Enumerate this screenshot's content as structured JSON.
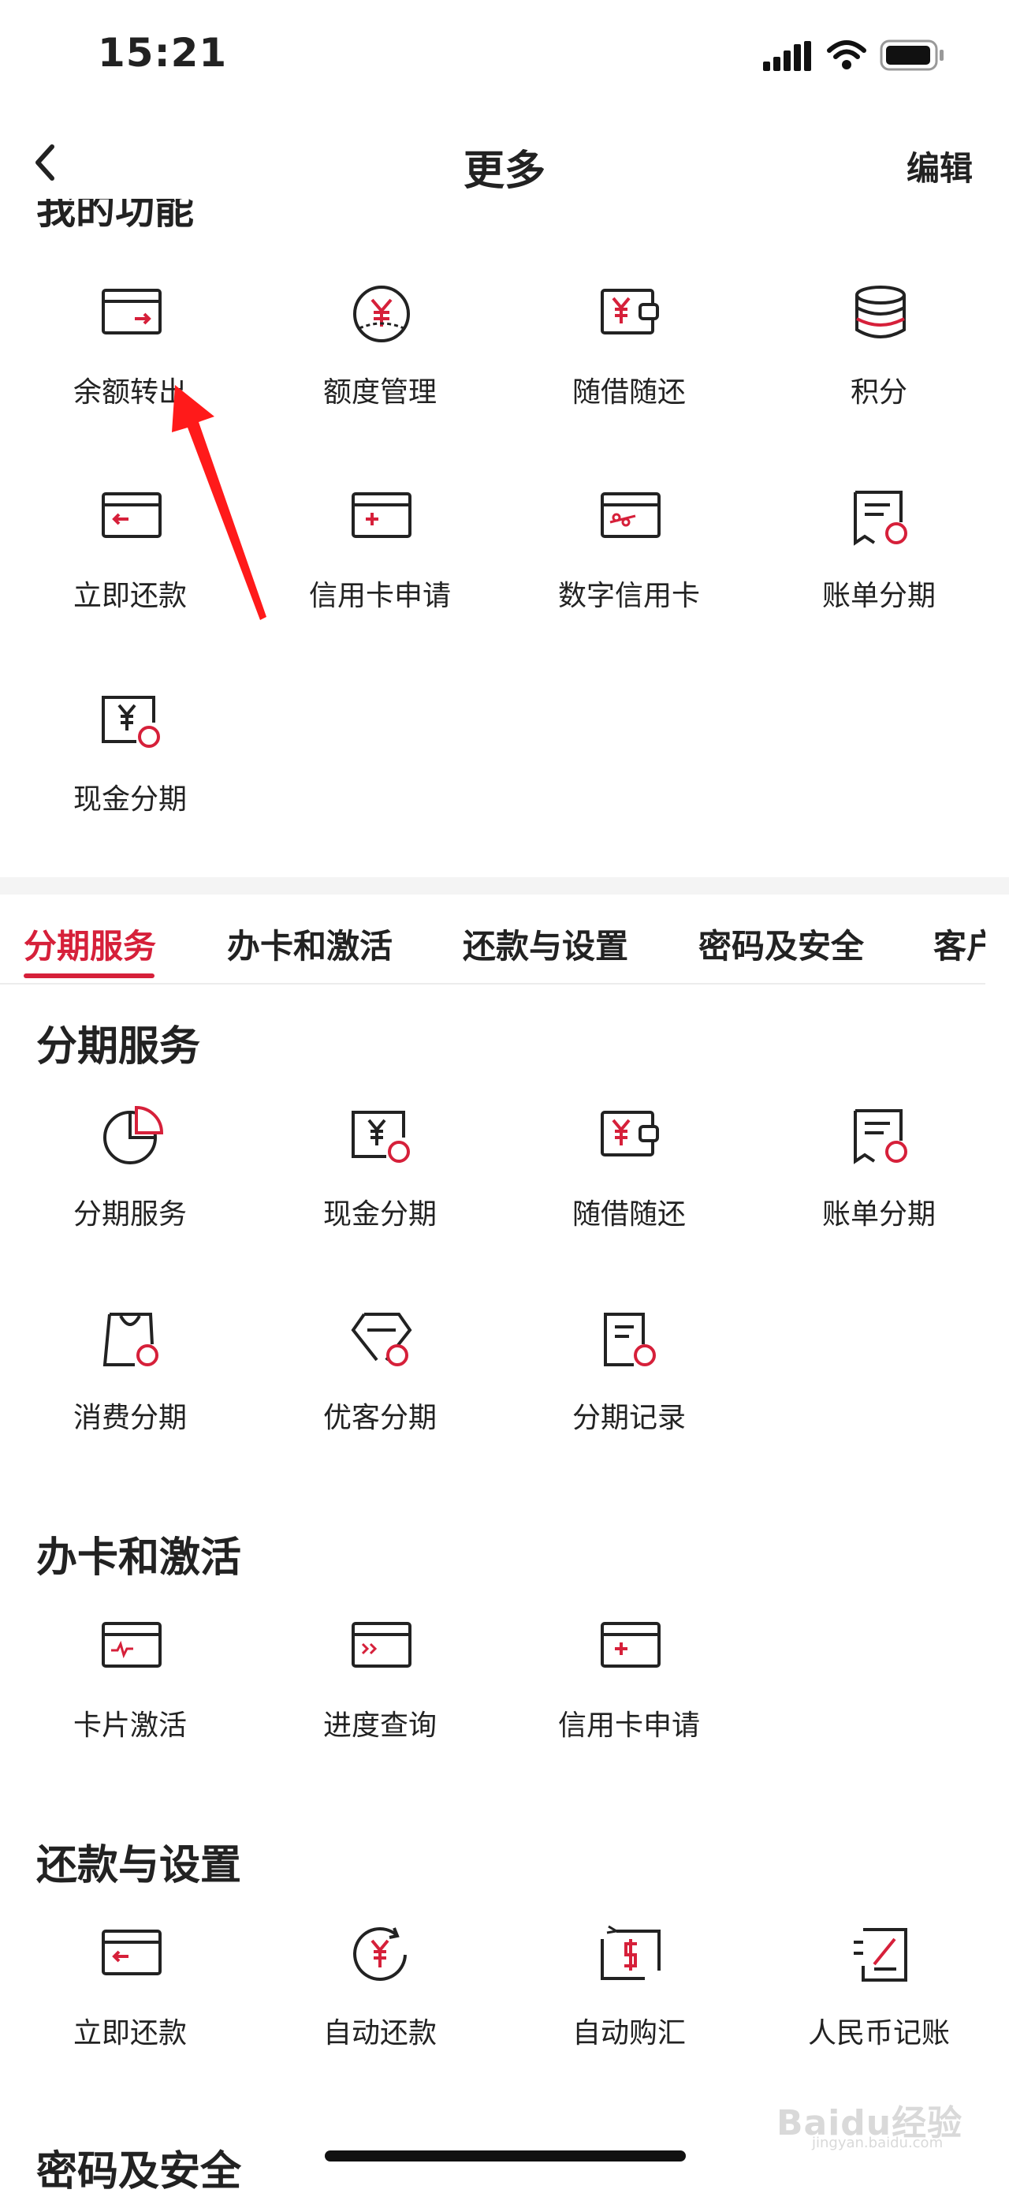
{
  "status_bar": {
    "time": "15:21"
  },
  "navbar": {
    "title": "更多",
    "edit": "编辑"
  },
  "my_functions": {
    "title": "我的功能",
    "items": [
      {
        "label": "余额转出",
        "icon": "card-transfer-out-icon"
      },
      {
        "label": "额度管理",
        "icon": "yuan-limit-icon"
      },
      {
        "label": "随借随还",
        "icon": "yuan-wallet-icon"
      },
      {
        "label": "积分",
        "icon": "points-stack-icon"
      },
      {
        "label": "立即还款",
        "icon": "card-repay-icon"
      },
      {
        "label": "信用卡申请",
        "icon": "card-apply-icon"
      },
      {
        "label": "数字信用卡",
        "icon": "digital-card-icon"
      },
      {
        "label": "账单分期",
        "icon": "bill-installment-icon"
      },
      {
        "label": "现金分期",
        "icon": "cash-installment-icon"
      }
    ]
  },
  "tabs": [
    "分期服务",
    "办卡和激活",
    "还款与设置",
    "密码及安全",
    "客户"
  ],
  "installment": {
    "title": "分期服务",
    "items": [
      {
        "label": "分期服务",
        "icon": "pie-chart-icon"
      },
      {
        "label": "现金分期",
        "icon": "cash-installment-icon"
      },
      {
        "label": "随借随还",
        "icon": "yuan-wallet-icon"
      },
      {
        "label": "账单分期",
        "icon": "bill-installment-icon"
      },
      {
        "label": "消费分期",
        "icon": "shopping-bag-icon"
      },
      {
        "label": "优客分期",
        "icon": "diamond-icon"
      },
      {
        "label": "分期记录",
        "icon": "record-icon"
      }
    ]
  },
  "card_activation": {
    "title": "办卡和激活",
    "items": [
      {
        "label": "卡片激活",
        "icon": "card-activate-icon"
      },
      {
        "label": "进度查询",
        "icon": "progress-query-icon"
      },
      {
        "label": "信用卡申请",
        "icon": "card-apply-icon"
      }
    ]
  },
  "repay_settings": {
    "title": "还款与设置",
    "items": [
      {
        "label": "立即还款",
        "icon": "card-repay-icon"
      },
      {
        "label": "自动还款",
        "icon": "auto-repay-icon"
      },
      {
        "label": "自动购汇",
        "icon": "auto-exchange-icon"
      },
      {
        "label": "人民币记账",
        "icon": "rmb-ledger-icon"
      }
    ]
  },
  "security": {
    "title": "密码及安全"
  },
  "watermark": {
    "brand": "Baidu经验",
    "url": "jingyan.baidu.com"
  },
  "colors": {
    "accent": "#d6203a",
    "text": "#222222",
    "divider": "#f4f4f4"
  }
}
